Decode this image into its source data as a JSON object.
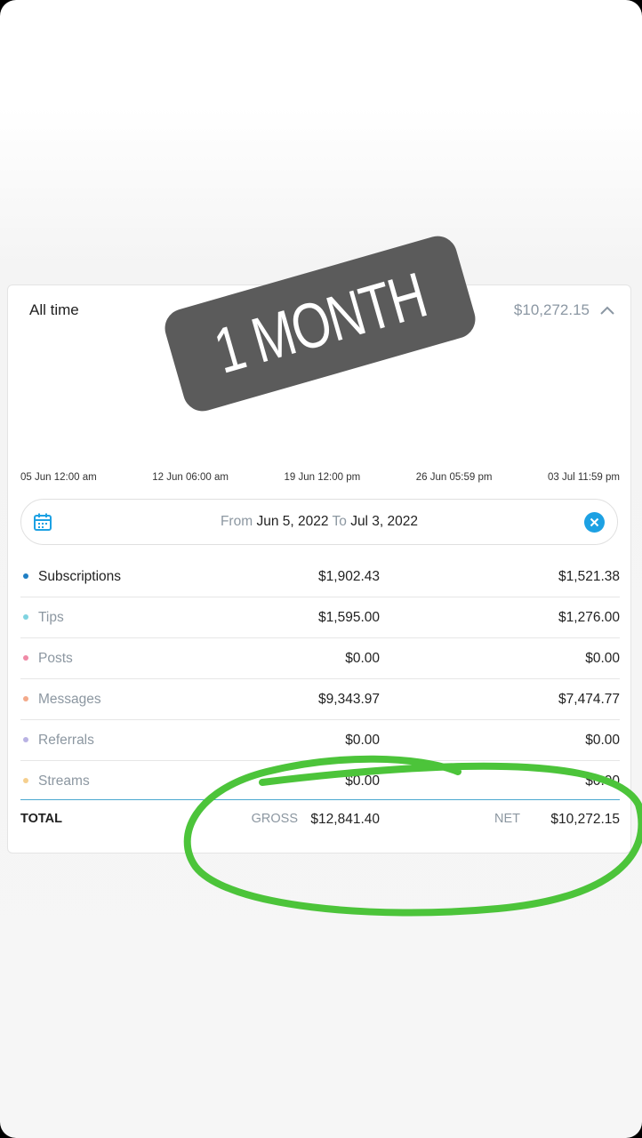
{
  "card": {
    "title": "All time",
    "total": "$10,272.15"
  },
  "chart_data": {
    "type": "line",
    "x_tick_labels": [
      "05 Jun 12:00 am",
      "12 Jun 06:00 am",
      "19 Jun 12:00 pm",
      "26 Jun 05:59 pm",
      "03 Jul 11:59 pm"
    ]
  },
  "date_range": {
    "from_label": "From",
    "from_value": "Jun 5, 2022",
    "to_label": "To",
    "to_value": "Jul 3, 2022"
  },
  "rows": [
    {
      "name": "Subscriptions",
      "gross": "$1,902.43",
      "net": "$1,521.38",
      "color": "#1f7fc4"
    },
    {
      "name": "Tips",
      "gross": "$1,595.00",
      "net": "$1,276.00",
      "color": "#7fd3e0"
    },
    {
      "name": "Posts",
      "gross": "$0.00",
      "net": "$0.00",
      "color": "#ef8aa6"
    },
    {
      "name": "Messages",
      "gross": "$9,343.97",
      "net": "$7,474.77",
      "color": "#f3a98a"
    },
    {
      "name": "Referrals",
      "gross": "$0.00",
      "net": "$0.00",
      "color": "#b9b2e3"
    },
    {
      "name": "Streams",
      "gross": "$0.00",
      "net": "$0.00",
      "color": "#f5cf8e"
    }
  ],
  "totals": {
    "label": "TOTAL",
    "gross_label": "GROSS",
    "gross_value": "$12,841.40",
    "net_label": "NET",
    "net_value": "$10,272.15"
  },
  "overlay": {
    "sticker_text": "1 MONTH",
    "sticker_color": "#5b5b5b",
    "circle_color": "#4cc43a"
  },
  "icons": {
    "calendar": "calendar-icon",
    "clear": "close-icon",
    "collapse": "chevron-up-icon"
  }
}
